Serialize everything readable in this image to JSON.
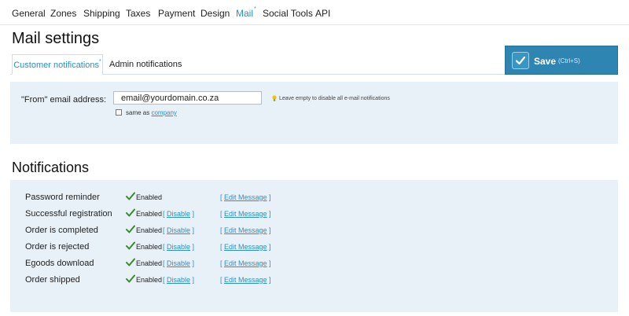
{
  "nav": {
    "items": [
      {
        "label": "General"
      },
      {
        "label": "Zones"
      },
      {
        "label": "Shipping"
      },
      {
        "label": "Taxes"
      },
      {
        "label": "Payment"
      },
      {
        "label": "Design"
      },
      {
        "label": "Mail",
        "marker": "*"
      },
      {
        "label": "Social Tools"
      },
      {
        "label": "API"
      }
    ]
  },
  "page": {
    "title": "Mail settings"
  },
  "tabs": [
    {
      "label": "Customer notifications",
      "marker": "*"
    },
    {
      "label": "Admin notifications"
    }
  ],
  "save": {
    "label": "Save",
    "shortcut": "(Ctrl+S)"
  },
  "email": {
    "label": "\"From\" email address:",
    "value": "email@yourdomain.co.za",
    "hint": "Leave empty to disable all e-mail notifications",
    "same_as_text": "same as",
    "same_as_link": "company"
  },
  "notifications": {
    "title": "Notifications",
    "rows": [
      {
        "label": "Password reminder",
        "status": "Enabled",
        "disable": null,
        "edit": "Edit Message"
      },
      {
        "label": "Successful registration",
        "status": "Enabled",
        "disable": "Disable",
        "edit": "Edit Message"
      },
      {
        "label": "Order is completed",
        "status": "Enabled",
        "disable": "Disable",
        "edit": "Edit Message"
      },
      {
        "label": "Order is rejected",
        "status": "Enabled",
        "disable": "Disable",
        "edit": "Edit Message"
      },
      {
        "label": "Egoods download",
        "status": "Enabled",
        "disable": "Disable",
        "edit": "Edit Message"
      },
      {
        "label": "Order shipped",
        "status": "Enabled",
        "disable": "Disable",
        "edit": "Edit Message"
      }
    ]
  },
  "colors": {
    "accent": "#2b8fc8",
    "save_bg": "#2e85b2",
    "panel_bg": "#e8f1f8",
    "check_green": "#3a8a2a"
  }
}
